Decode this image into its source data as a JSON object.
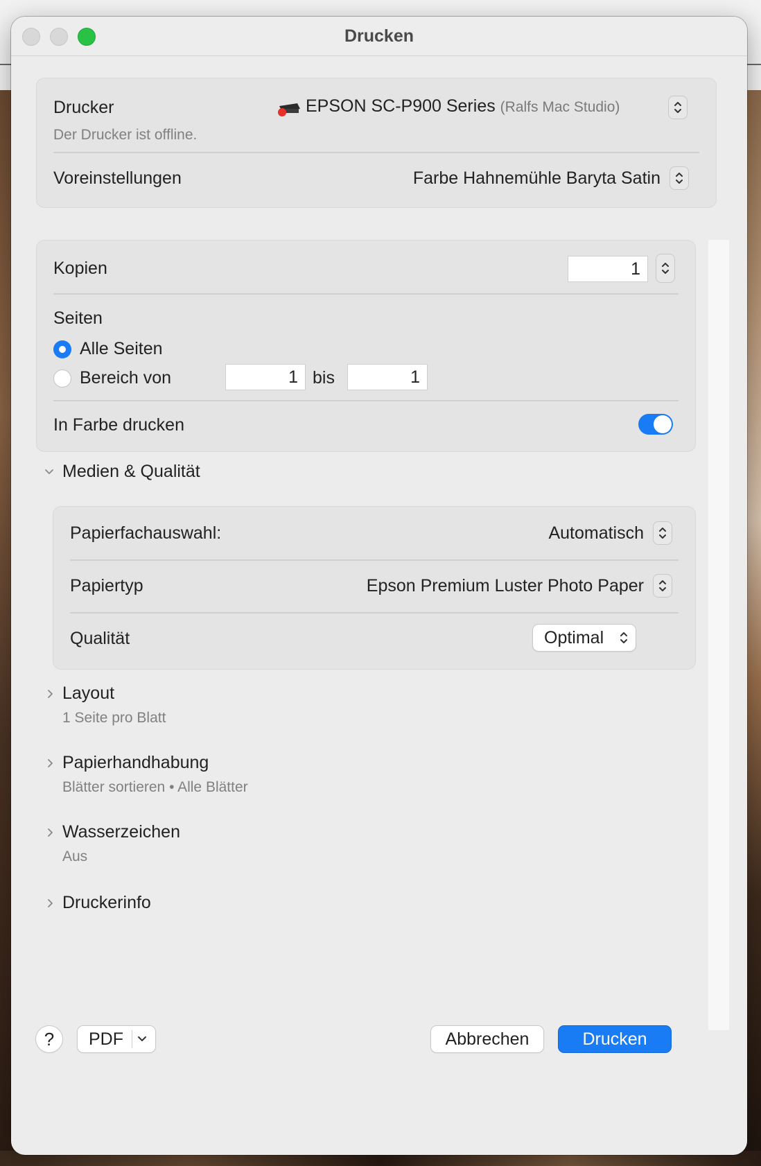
{
  "window": {
    "title": "Drucken"
  },
  "printer_card": {
    "printer_label": "Drucker",
    "printer_name": "EPSON SC-P900 Series",
    "printer_host": "(Ralfs Mac Studio)",
    "printer_status": "Der Drucker ist offline.",
    "presets_label": "Voreinstellungen",
    "presets_value": "Farbe Hahnemühle Baryta Satin"
  },
  "copies_card": {
    "copies_label": "Kopien",
    "copies_value": "1",
    "pages_label": "Seiten",
    "all_pages_label": "Alle Seiten",
    "range_label": "Bereich von",
    "range_from": "1",
    "range_to_label": "bis",
    "range_to": "1",
    "color_label": "In Farbe drucken",
    "color_on": true
  },
  "media_section": {
    "title": "Medien & Qualität",
    "tray_label": "Papierfachauswahl:",
    "tray_value": "Automatisch",
    "paper_type_label": "Papiertyp",
    "paper_type_value": "Epson Premium Luster Photo Paper",
    "quality_label": "Qualität",
    "quality_value": "Optimal"
  },
  "sections": [
    {
      "title": "Layout",
      "summary": "1 Seite pro Blatt"
    },
    {
      "title": "Papierhandhabung",
      "summary": "Blätter sortieren • Alle Blätter"
    },
    {
      "title": "Wasserzeichen",
      "summary": "Aus"
    },
    {
      "title": "Druckerinfo",
      "summary": ""
    }
  ],
  "footer": {
    "help_label": "?",
    "pdf_label": "PDF",
    "cancel_label": "Abbrechen",
    "print_label": "Drucken"
  },
  "colors": {
    "accent": "#1a7cf5",
    "zoom_light": "#2ac245",
    "offline_dot": "#e8302b"
  }
}
